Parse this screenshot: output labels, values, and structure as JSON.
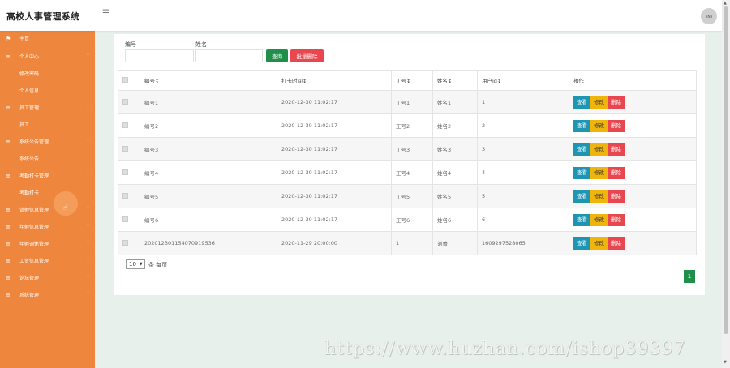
{
  "app": {
    "title": "高校人事管理系统",
    "avatar_text": "BNB"
  },
  "sidebar": {
    "items": [
      {
        "label": "主页",
        "type": "parent",
        "icon": "flag-icon"
      },
      {
        "label": "个人中心",
        "type": "parent",
        "icon": "list-icon"
      },
      {
        "label": "修改密码",
        "type": "child"
      },
      {
        "label": "个人信息",
        "type": "child"
      },
      {
        "label": "员工管理",
        "type": "parent",
        "icon": "list-icon"
      },
      {
        "label": "员工",
        "type": "child"
      },
      {
        "label": "系统公告管理",
        "type": "parent",
        "icon": "list-icon"
      },
      {
        "label": "系统公告",
        "type": "child"
      },
      {
        "label": "考勤打卡管理",
        "type": "parent",
        "icon": "list-icon"
      },
      {
        "label": "考勤打卡",
        "type": "child"
      },
      {
        "label": "请假信息管理",
        "type": "parent",
        "icon": "list-icon"
      },
      {
        "label": "年假信息管理",
        "type": "parent",
        "icon": "list-icon"
      },
      {
        "label": "年假调休管理",
        "type": "parent",
        "icon": "list-icon"
      },
      {
        "label": "工资信息管理",
        "type": "parent",
        "icon": "list-icon"
      },
      {
        "label": "论坛管理",
        "type": "parent",
        "icon": "list-icon"
      },
      {
        "label": "系统管理",
        "type": "parent",
        "icon": "list-icon"
      }
    ]
  },
  "search": {
    "field1_label": "编号",
    "field2_label": "姓名",
    "field1_value": "",
    "field2_value": "",
    "query_label": "查询",
    "batch_delete_label": "批量删除"
  },
  "table": {
    "headers": [
      "编号↕",
      "打卡时间↕",
      "工号↕",
      "姓名↕",
      "用户id↕",
      "操作"
    ],
    "rows": [
      [
        "编号1",
        "2020-12-30 11:02:17",
        "工号1",
        "姓名1",
        "1"
      ],
      [
        "编号2",
        "2020-12-30 11:02:17",
        "工号2",
        "姓名2",
        "2"
      ],
      [
        "编号3",
        "2020-12-30 11:02:17",
        "工号3",
        "姓名3",
        "3"
      ],
      [
        "编号4",
        "2020-12-30 11:02:17",
        "工号4",
        "姓名4",
        "4"
      ],
      [
        "编号5",
        "2020-12-30 11:02:17",
        "工号5",
        "姓名5",
        "5"
      ],
      [
        "编号6",
        "2020-12-30 11:02:17",
        "工号6",
        "姓名6",
        "6"
      ],
      [
        "20201230115407091953​6",
        "2020-11-29 20:00:00",
        "1",
        "刘菁",
        "1609297528065"
      ]
    ],
    "actions": {
      "view": "查看",
      "edit": "修改",
      "delete": "删除"
    }
  },
  "pager": {
    "page_size": "10",
    "page_size_suffix": "条 每页",
    "current_page": "1"
  },
  "watermark": "https://www.huzhan.com/ishop39397",
  "colors": {
    "sidebar": "#ef863d",
    "primary_green": "#1f8f4a",
    "danger": "#e8474f",
    "info": "#1e96b3",
    "warning": "#f0b50d"
  }
}
